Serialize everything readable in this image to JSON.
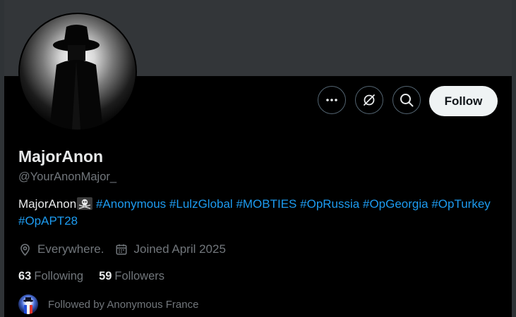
{
  "profile": {
    "display_name": "MajorAnon",
    "handle": "@YourAnonMajor_",
    "bio": {
      "text": "MajorAnon",
      "hashtags": [
        "#Anonymous",
        "#LulzGlobal",
        "#MOBTIES",
        "#OpRussia",
        "#OpGeorgia",
        "#OpTurkey",
        "#OpAPT28"
      ]
    },
    "location": "Everywhere.",
    "joined": "Joined April 2025",
    "following_count": "63",
    "following_label": "Following",
    "followers_count": "59",
    "followers_label": "Followers",
    "followed_by": "Followed by Anonymous France"
  },
  "actions": {
    "more_icon": "more-horizontal-icon",
    "grok_icon": "grok-slash-circle-icon",
    "search_icon": "search-icon",
    "follow_label": "Follow"
  },
  "colors": {
    "background": "#000000",
    "banner": "#333639",
    "hashtag": "#1d9bf0",
    "secondary_text": "#71767b",
    "follow_button_bg": "#eff3f4"
  }
}
